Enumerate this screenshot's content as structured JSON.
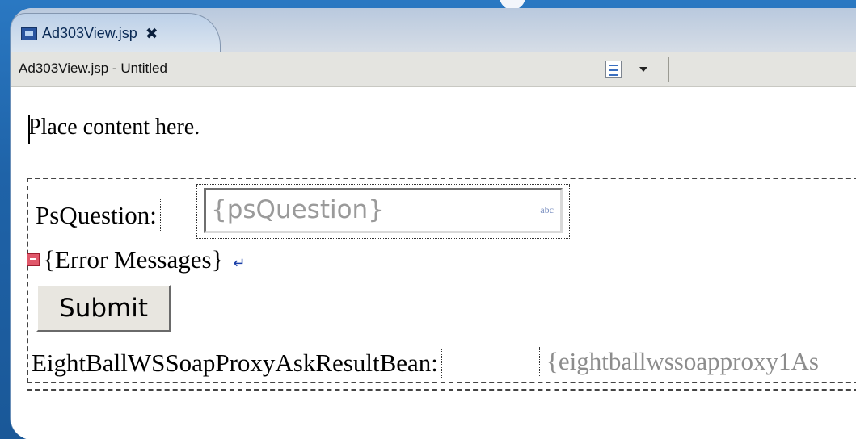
{
  "editor_tab": {
    "title": "Ad303View.jsp",
    "close_glyph": "✖"
  },
  "titlebar": {
    "document_title": "Ad303View.jsp - Untitled"
  },
  "canvas": {
    "placeholder_text": "Place content here.",
    "form": {
      "question_label": "PsQuestion:",
      "question_value": "{psQuestion}",
      "input_badge": "abc",
      "error_messages": "{Error Messages}",
      "newline_glyph": "↵",
      "submit_label": "Submit",
      "result_label": "EightBallWSSoapProxyAskResultBean:",
      "result_value": "{eightballwssoapproxy1As"
    }
  },
  "icons": {
    "tab": "jsp-file-icon",
    "toolbar": "page-properties-icon",
    "error": "error-messages-icon"
  }
}
